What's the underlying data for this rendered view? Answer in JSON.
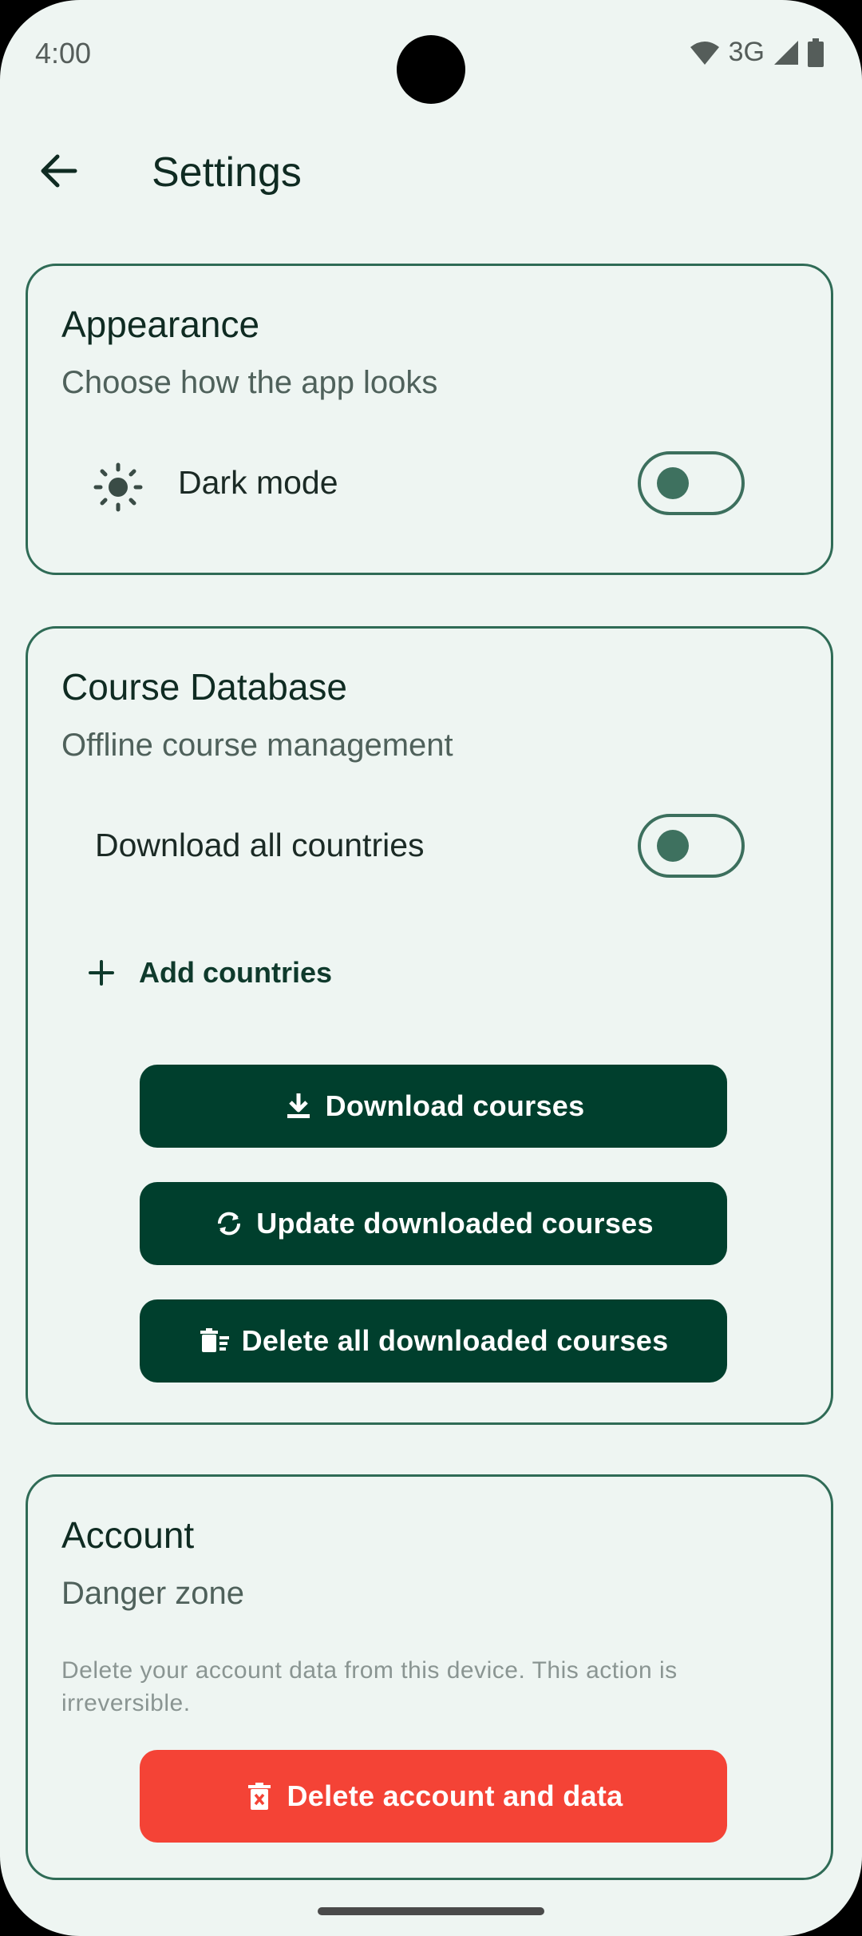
{
  "status_bar": {
    "time": "4:00",
    "network": "3G",
    "icons": [
      "wifi-icon",
      "signal-icon",
      "battery-icon"
    ]
  },
  "app_bar": {
    "title": "Settings",
    "back_icon": "arrow-back-icon"
  },
  "appearance": {
    "title": "Appearance",
    "subtitle": "Choose how the app looks",
    "dark_mode_label": "Dark mode",
    "dark_mode_icon": "sun-icon",
    "dark_mode_on": false
  },
  "course_database": {
    "title": "Course Database",
    "subtitle": "Offline course management",
    "download_all_label": "Download all countries",
    "download_all_on": false,
    "add_countries_label": "Add countries",
    "buttons": {
      "download": "Download courses",
      "update": "Update downloaded courses",
      "delete_all": "Delete all downloaded courses"
    }
  },
  "account": {
    "title": "Account",
    "subtitle": "Danger zone",
    "hint": "Delete your account data from this device. This action is irreversible.",
    "delete_button": "Delete account and data"
  },
  "colors": {
    "primary": "#003f2d",
    "danger": "#f44336",
    "background": "#eef5f2",
    "outline": "#2f6b56"
  }
}
